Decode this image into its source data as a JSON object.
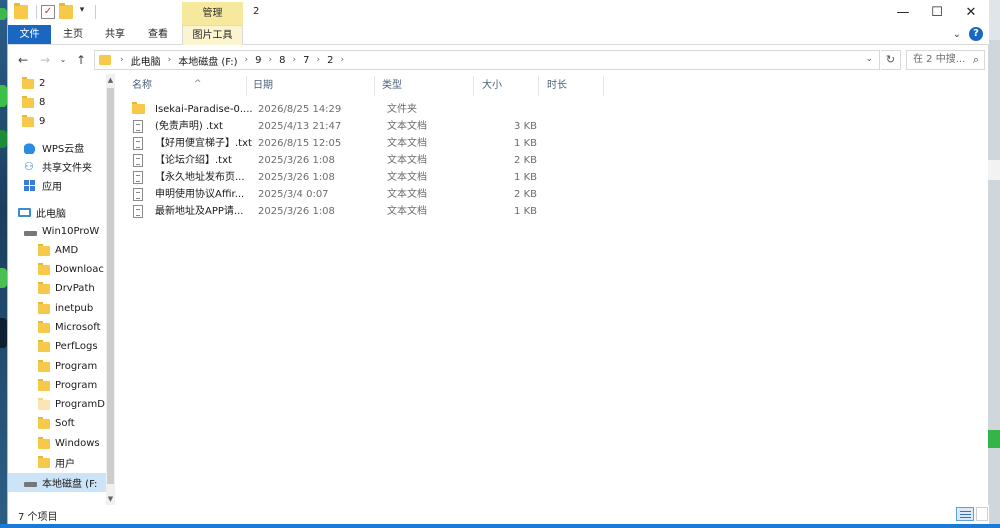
{
  "window": {
    "title": "2",
    "contextual_tab": "管理",
    "minimize_glyph": "—",
    "maximize_glyph": "☐",
    "close_glyph": "✕"
  },
  "ribbon": {
    "tabs": [
      "文件",
      "主页",
      "共享",
      "查看",
      "图片工具"
    ],
    "expand_glyph": "⌄",
    "help_glyph": "?"
  },
  "address": {
    "crumbs": [
      "此电脑",
      "本地磁盘 (F:)",
      "9",
      "8",
      "7",
      "2"
    ],
    "separator": "›",
    "search_placeholder": "在 2 中搜..."
  },
  "nav": {
    "items": [
      {
        "label": "2",
        "icon": "folder-icon"
      },
      {
        "label": "8",
        "icon": "folder-icon"
      },
      {
        "label": "9",
        "icon": "folder-icon"
      },
      {
        "label": "WPS云盘",
        "icon": "cloud-icon"
      },
      {
        "label": "共享文件夹",
        "icon": "share-icon"
      },
      {
        "label": "应用",
        "icon": "apps-icon"
      },
      {
        "label": "此电脑",
        "icon": "pc-icon"
      },
      {
        "label": "Win10ProW",
        "icon": "drive-icon"
      },
      {
        "label": "AMD",
        "icon": "folder-icon"
      },
      {
        "label": "Downloac",
        "icon": "folder-icon"
      },
      {
        "label": "DrvPath",
        "icon": "folder-icon"
      },
      {
        "label": "inetpub",
        "icon": "folder-icon"
      },
      {
        "label": "Microsoft",
        "icon": "folder-icon"
      },
      {
        "label": "PerfLogs",
        "icon": "folder-icon"
      },
      {
        "label": "Program",
        "icon": "folder-icon"
      },
      {
        "label": "Program",
        "icon": "folder-icon"
      },
      {
        "label": "ProgramD",
        "icon": "folder-icon"
      },
      {
        "label": "Soft",
        "icon": "folder-icon"
      },
      {
        "label": "Windows",
        "icon": "folder-icon"
      },
      {
        "label": "用户",
        "icon": "folder-icon"
      },
      {
        "label": "本地磁盘 (F:",
        "icon": "drive-icon"
      }
    ]
  },
  "columns": {
    "name": "名称",
    "date": "日期",
    "type": "类型",
    "size": "大小",
    "duration": "时长"
  },
  "files": [
    {
      "name": "Isekai-Paradise-0....",
      "date": "2026/8/25 14:29",
      "type": "文件夹",
      "size": "",
      "kind": "folder"
    },
    {
      "name": "(免责声明) .txt",
      "date": "2025/4/13 21:47",
      "type": "文本文档",
      "size": "3 KB",
      "kind": "txt"
    },
    {
      "name": "【好用便宜梯子】.txt",
      "date": "2026/8/15 12:05",
      "type": "文本文档",
      "size": "1 KB",
      "kind": "txt"
    },
    {
      "name": "【论坛介绍】.txt",
      "date": "2025/3/26 1:08",
      "type": "文本文档",
      "size": "2 KB",
      "kind": "txt"
    },
    {
      "name": "【永久地址发布页...",
      "date": "2025/3/26 1:08",
      "type": "文本文档",
      "size": "1 KB",
      "kind": "txt"
    },
    {
      "name": "申明使用协议Affir...",
      "date": "2025/3/4 0:07",
      "type": "文本文档",
      "size": "2 KB",
      "kind": "txt"
    },
    {
      "name": "最新地址及APP请...",
      "date": "2025/3/26 1:08",
      "type": "文本文档",
      "size": "1 KB",
      "kind": "txt"
    }
  ],
  "status": {
    "item_count": "7 个项目"
  },
  "colors": {
    "file_tab": "#1a67c2",
    "contextual_tab": "#f6e89c",
    "selection": "#cce4f7",
    "folder": "#f6c94a"
  }
}
